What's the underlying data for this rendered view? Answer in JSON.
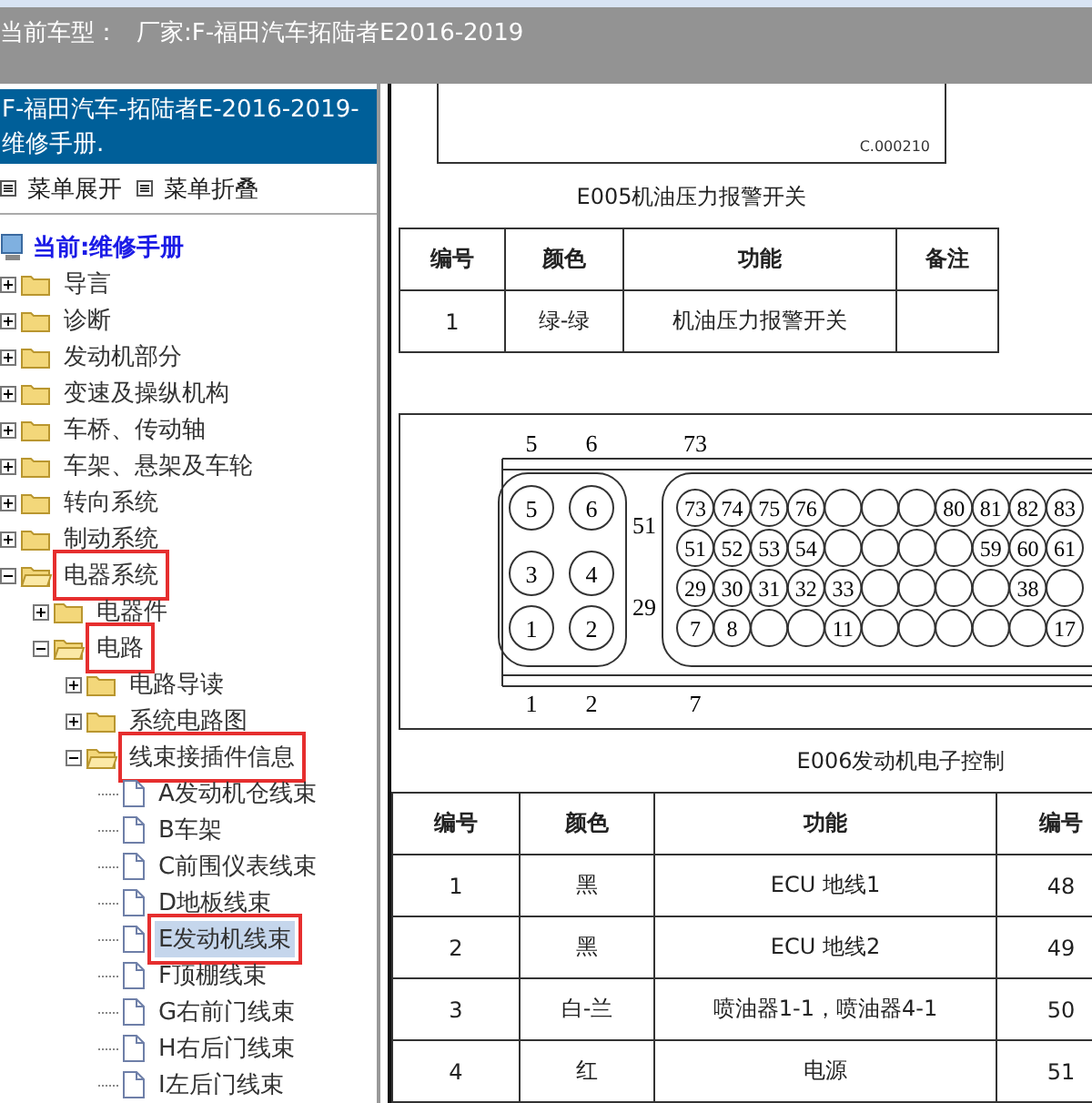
{
  "top_bar": {
    "label": "当前车型：",
    "vehicle": "厂家:F-福田汽车拓陆者E2016-2019"
  },
  "sidebar": {
    "header": "F-福田汽车-拓陆者E-2016-2019- 维修手册.",
    "menu_buttons": [
      {
        "label": "菜单展开"
      },
      {
        "label": "菜单折叠"
      }
    ],
    "root": "当前:维修手册",
    "tree": [
      {
        "label": "导言",
        "kind": "folder",
        "expanded": false,
        "highlighted": false,
        "selected": false
      },
      {
        "label": "诊断",
        "kind": "folder",
        "expanded": false,
        "highlighted": false,
        "selected": false
      },
      {
        "label": "发动机部分",
        "kind": "folder",
        "expanded": false,
        "highlighted": false,
        "selected": false
      },
      {
        "label": "变速及操纵机构",
        "kind": "folder",
        "expanded": false,
        "highlighted": false,
        "selected": false
      },
      {
        "label": "车桥、传动轴",
        "kind": "folder",
        "expanded": false,
        "highlighted": false,
        "selected": false
      },
      {
        "label": "车架、悬架及车轮",
        "kind": "folder",
        "expanded": false,
        "highlighted": false,
        "selected": false
      },
      {
        "label": "转向系统",
        "kind": "folder",
        "expanded": false,
        "highlighted": false,
        "selected": false
      },
      {
        "label": "制动系统",
        "kind": "folder",
        "expanded": false,
        "highlighted": false,
        "selected": false
      },
      {
        "label": "电器系统",
        "kind": "folder",
        "expanded": true,
        "highlighted": true,
        "selected": false,
        "children": [
          {
            "label": "电器件",
            "kind": "folder",
            "expanded": false,
            "highlighted": false,
            "selected": false
          },
          {
            "label": "电路",
            "kind": "folder",
            "expanded": true,
            "highlighted": true,
            "selected": false,
            "children": [
              {
                "label": "电路导读",
                "kind": "folder",
                "expanded": false,
                "highlighted": false,
                "selected": false
              },
              {
                "label": "系统电路图",
                "kind": "folder",
                "expanded": false,
                "highlighted": false,
                "selected": false
              },
              {
                "label": "线束接插件信息",
                "kind": "folder",
                "expanded": true,
                "highlighted": true,
                "selected": false,
                "children": [
                  {
                    "label": "A发动机仓线束",
                    "kind": "page",
                    "highlighted": false,
                    "selected": false
                  },
                  {
                    "label": "B车架",
                    "kind": "page",
                    "highlighted": false,
                    "selected": false
                  },
                  {
                    "label": "C前围仪表线束",
                    "kind": "page",
                    "highlighted": false,
                    "selected": false
                  },
                  {
                    "label": "D地板线束",
                    "kind": "page",
                    "highlighted": false,
                    "selected": false
                  },
                  {
                    "label": "E发动机线束",
                    "kind": "page",
                    "highlighted": true,
                    "selected": true
                  },
                  {
                    "label": "F顶棚线束",
                    "kind": "page",
                    "highlighted": false,
                    "selected": false
                  },
                  {
                    "label": "G右前门线束",
                    "kind": "page",
                    "highlighted": false,
                    "selected": false
                  },
                  {
                    "label": "H右后门线束",
                    "kind": "page",
                    "highlighted": false,
                    "selected": false
                  },
                  {
                    "label": "I左后门线束",
                    "kind": "page",
                    "highlighted": false,
                    "selected": false
                  }
                ]
              }
            ]
          }
        ]
      }
    ]
  },
  "document": {
    "figure_1": {
      "code": "C.000210"
    },
    "caption_1": "E005机油压力报警开关",
    "table_1": {
      "columns": [
        "编号",
        "颜色",
        "功能",
        "备注"
      ],
      "rows": [
        [
          "1",
          "绿-绿",
          "机油压力报警开关"
        ]
      ]
    },
    "connector": {
      "small_top_labels": [
        "5",
        "6"
      ],
      "small_bottom_labels": [
        "1",
        "2"
      ],
      "small_pins": [
        [
          "5",
          "6"
        ],
        [
          "3",
          "4"
        ],
        [
          "1",
          "2"
        ]
      ],
      "large_top_label": "73",
      "large_side_labels": [
        "51",
        "29"
      ],
      "large_bottom_label": "7",
      "large_pins": [
        [
          {
            "kind": "numbered",
            "label": "73"
          },
          {
            "kind": "numbered",
            "label": "74"
          },
          {
            "kind": "numbered",
            "label": "75"
          },
          {
            "kind": "numbered",
            "label": "76"
          },
          {
            "kind": "blank"
          },
          {
            "kind": "blank"
          },
          {
            "kind": "blank"
          },
          {
            "kind": "numbered",
            "label": "80"
          },
          {
            "kind": "numbered",
            "label": "81"
          },
          {
            "kind": "numbered",
            "label": "82"
          },
          {
            "kind": "numbered",
            "label": "83"
          }
        ],
        [
          {
            "kind": "numbered",
            "label": "51"
          },
          {
            "kind": "numbered",
            "label": "52"
          },
          {
            "kind": "numbered",
            "label": "53"
          },
          {
            "kind": "numbered",
            "label": "54"
          },
          {
            "kind": "blank"
          },
          {
            "kind": "blank"
          },
          {
            "kind": "blank"
          },
          {
            "kind": "blank"
          },
          {
            "kind": "numbered",
            "label": "59"
          },
          {
            "kind": "numbered",
            "label": "60"
          },
          {
            "kind": "numbered",
            "label": "61"
          }
        ],
        [
          {
            "kind": "numbered",
            "label": "29"
          },
          {
            "kind": "numbered",
            "label": "30"
          },
          {
            "kind": "numbered",
            "label": "31"
          },
          {
            "kind": "numbered",
            "label": "32"
          },
          {
            "kind": "numbered",
            "label": "33"
          },
          {
            "kind": "blank"
          },
          {
            "kind": "blank"
          },
          {
            "kind": "blank"
          },
          {
            "kind": "blank"
          },
          {
            "kind": "numbered",
            "label": "38"
          },
          {
            "kind": "blank"
          }
        ],
        [
          {
            "kind": "numbered",
            "label": "7"
          },
          {
            "kind": "numbered",
            "label": "8"
          },
          {
            "kind": "blank"
          },
          {
            "kind": "blank"
          },
          {
            "kind": "numbered",
            "label": "11"
          },
          {
            "kind": "blank"
          },
          {
            "kind": "blank"
          },
          {
            "kind": "blank"
          },
          {
            "kind": "blank"
          },
          {
            "kind": "blank"
          },
          {
            "kind": "numbered",
            "label": "17"
          }
        ]
      ]
    },
    "caption_2": "E006发动机电子控制",
    "table_2": {
      "columns": [
        "编号",
        "颜色",
        "功能",
        "编号"
      ],
      "rows": [
        [
          "1",
          "黑",
          "ECU 地线1",
          "48"
        ],
        [
          "2",
          "黑",
          "ECU 地线2",
          "49"
        ],
        [
          "3",
          "白-兰",
          "喷油器1-1，喷油器4-1",
          "50"
        ],
        [
          "4",
          "红",
          "电源",
          "51"
        ]
      ]
    }
  }
}
